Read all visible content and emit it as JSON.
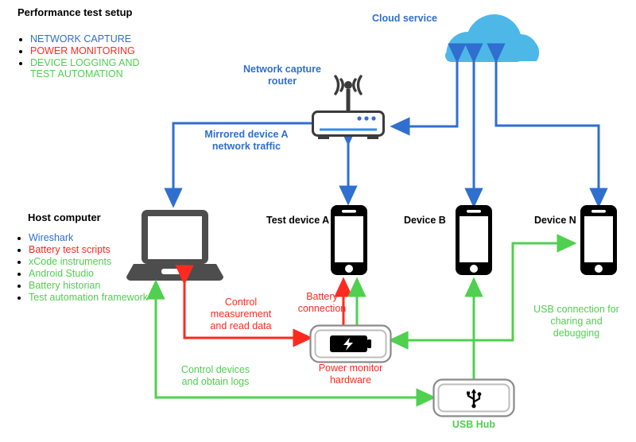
{
  "header": {
    "title": "Performance test setup",
    "legend": [
      {
        "label": "NETWORK CAPTURE",
        "color": "#2f6fd0"
      },
      {
        "label": "POWER MONITORING",
        "color": "#ff2a1f"
      },
      {
        "label": "DEVICE LOGGING AND\nTEST AUTOMATION",
        "color": "#4fd04f"
      }
    ]
  },
  "host": {
    "title": "Host computer",
    "tools": [
      {
        "label": "Wireshark",
        "color": "#2f6fd0"
      },
      {
        "label": "Battery test scripts",
        "color": "#ff2a1f"
      },
      {
        "label": "xCode instruments",
        "color": "#4fd04f"
      },
      {
        "label": "Android Studio",
        "color": "#4fd04f"
      },
      {
        "label": "Battery historian",
        "color": "#4fd04f"
      },
      {
        "label": "Test automation framework",
        "color": "#4fd04f"
      }
    ]
  },
  "nodes": {
    "cloud": "Cloud service",
    "router": "Network capture\nrouter",
    "test_device_a": "Test device A",
    "device_b": "Device B",
    "device_n": "Device N",
    "power_monitor": "Power monitor\nhardware",
    "usb_hub": "USB Hub"
  },
  "edges": {
    "mirrored_traffic": "Mirrored device A\nnetwork traffic",
    "control_measurement": "Control\nmeasurement\nand read data",
    "battery_connection": "Battery\nconnection",
    "control_devices": "Control devices\nand obtain logs",
    "usb_connection": "USB connection for\ncharing and\ndebugging"
  },
  "colors": {
    "network_blue": "#2f6fd0",
    "power_red": "#ff2a1f",
    "logging_green": "#4fd04f",
    "cloud_fill": "#4db8e8",
    "device_black": "#000000",
    "laptop_gray": "#4d4d4d",
    "router_body": "#ffffff",
    "router_stroke": "#3b3b3b",
    "router_accent": "#2f8fe8"
  }
}
